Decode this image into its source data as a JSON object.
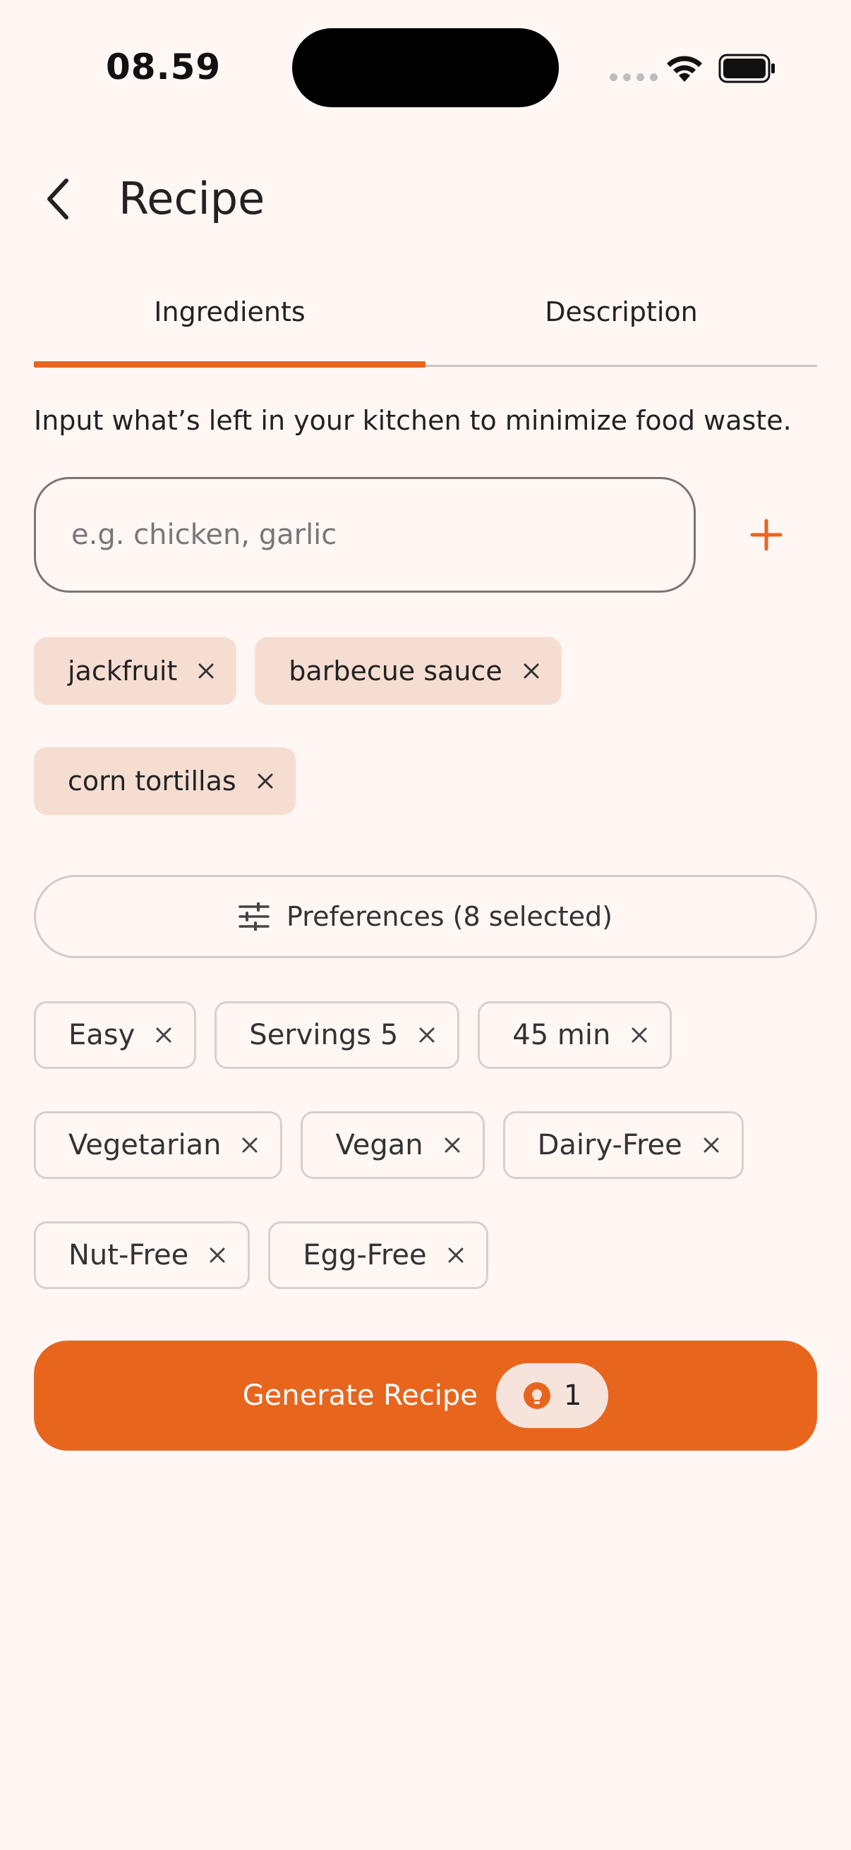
{
  "status_bar": {
    "time": "08.59"
  },
  "header": {
    "title": "Recipe"
  },
  "tabs": [
    {
      "label": "Ingredients",
      "active": true
    },
    {
      "label": "Description",
      "active": false
    }
  ],
  "hint": "Input what’s left in your kitchen to minimize food waste.",
  "ingredient_input": {
    "placeholder": "e.g. chicken, garlic",
    "value": ""
  },
  "ingredients": [
    "jackfruit",
    "barbecue sauce",
    "corn tortillas"
  ],
  "preferences_button": {
    "label": "Preferences (8 selected)"
  },
  "preferences": [
    "Easy",
    "Servings 5",
    "45 min",
    "Vegetarian",
    "Vegan",
    "Dairy-Free",
    "Nut-Free",
    "Egg-Free"
  ],
  "generate_button": {
    "label": "Generate Recipe",
    "credits": "1"
  },
  "colors": {
    "accent": "#E8651E",
    "background": "#FFF7F4",
    "chip_fill": "#F6DDD2"
  },
  "icons": {
    "back": "chevron-left-icon",
    "add": "plus-icon",
    "remove": "close-icon",
    "preferences": "sliders-icon",
    "credit": "credit-coin-icon"
  }
}
